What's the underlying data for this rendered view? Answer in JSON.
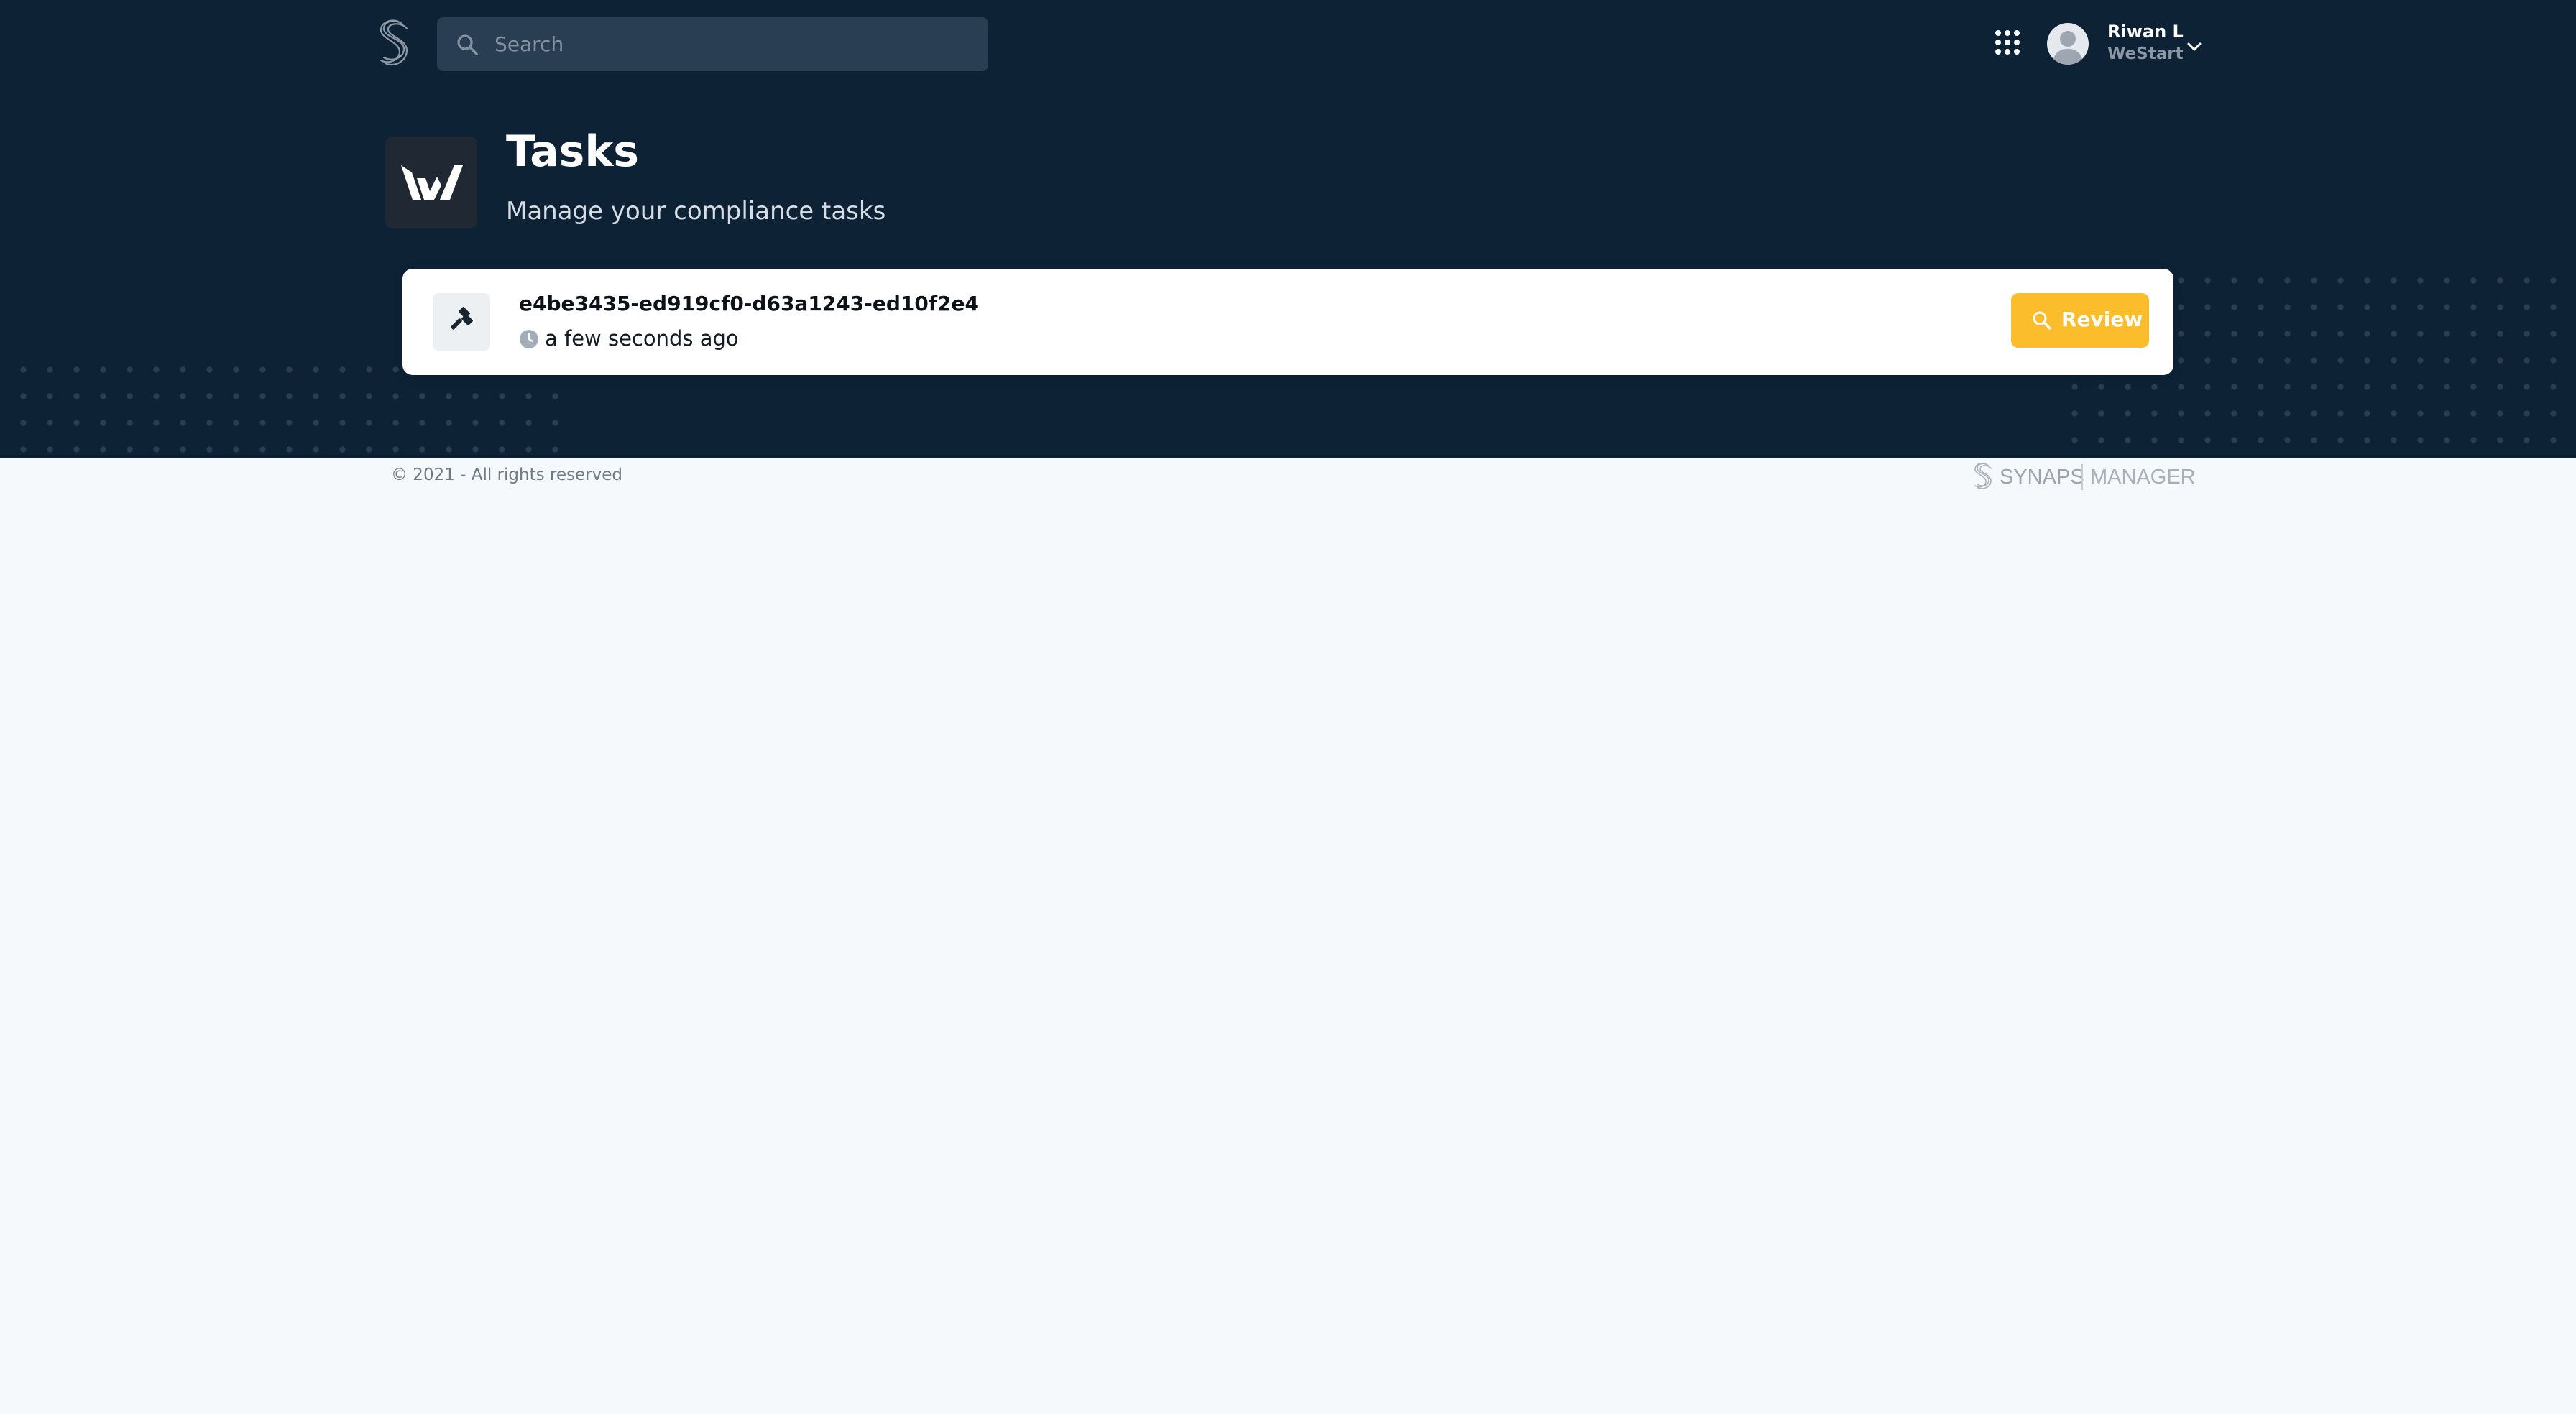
{
  "header": {
    "search_placeholder": "Search",
    "apps_icon": "grid-dots-icon",
    "user": {
      "name": "Riwan L",
      "organization": "WeStart"
    }
  },
  "page": {
    "title": "Tasks",
    "subtitle": "Manage your compliance tasks"
  },
  "tasks": [
    {
      "id": "e4be3435-ed919cf0-d63a1243-ed10f2e4",
      "time": "a few seconds ago",
      "type_icon": "gavel-icon",
      "action_label": "Review"
    }
  ],
  "footer": {
    "copyright": "© 2021 - All rights reserved",
    "brand_name": "SYNAPS",
    "brand_product": "MANAGER"
  },
  "colors": {
    "hero_background": "#0e2236",
    "accent": "#fbbd2c",
    "page_background": "#f6f9fb"
  }
}
